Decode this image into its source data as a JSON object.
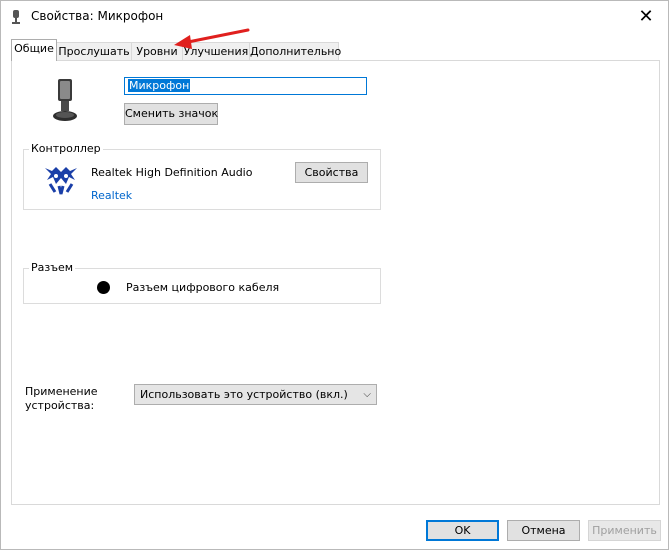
{
  "window": {
    "title": "Свойства: Микрофон",
    "close_glyph": "✕"
  },
  "tabs": [
    {
      "label": "Общие",
      "active": true
    },
    {
      "label": "Прослушать",
      "active": false
    },
    {
      "label": "Уровни",
      "active": false
    },
    {
      "label": "Улучшения",
      "active": false
    },
    {
      "label": "Дополнительно",
      "active": false
    }
  ],
  "device": {
    "name_value": "Микрофон",
    "change_icon_label": "Сменить значок"
  },
  "controller": {
    "group_label": "Контроллер",
    "name": "Realtek High Definition Audio",
    "vendor_link": "Realtek",
    "properties_button": "Свойства"
  },
  "jack": {
    "group_label": "Разъем",
    "text": "Разъем цифрового кабеля"
  },
  "usage": {
    "label_line1": "Применение",
    "label_line2": "устройства:",
    "selected": "Использовать это устройство (вкл.)"
  },
  "buttons": {
    "ok": "OK",
    "cancel": "Отмена",
    "apply": "Применить"
  },
  "colors": {
    "accent": "#0078d7",
    "annotation_arrow": "#e0201e",
    "link": "#0066cc"
  },
  "icons": [
    "microphone-icon",
    "realtek-logo-icon",
    "close-icon",
    "chevron-down-icon",
    "jack-dot-icon"
  ]
}
